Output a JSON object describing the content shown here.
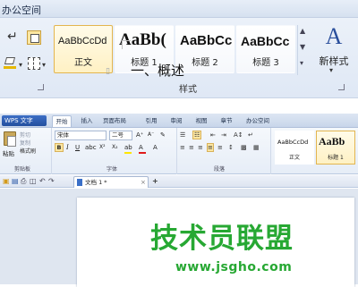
{
  "top_ribbon": {
    "tab_title": "办公空间",
    "styles": [
      {
        "sample": "AaBbCcDd",
        "caption": "正文",
        "selected": true
      },
      {
        "sample": "AaBb(",
        "caption": "标题 1",
        "selected": false
      },
      {
        "sample": "AaBbCc",
        "caption": "标题 2",
        "selected": false
      },
      {
        "sample": "AaBbCc",
        "caption": "标题 3",
        "selected": false
      }
    ],
    "new_style_label": "新样式",
    "new_style_icon_glyph": "A",
    "group_label": "样式",
    "anchor_glyph": "↵",
    "scroll_up": "▲",
    "scroll_down": "▼",
    "scroll_more": "▾",
    "dropdown_arrow": "▾"
  },
  "wps_window": {
    "app_button": "WPS 文字",
    "tabs": [
      {
        "label": "开始",
        "active": true
      },
      {
        "label": "插入",
        "active": false
      },
      {
        "label": "页面布局",
        "active": false
      },
      {
        "label": "引用",
        "active": false
      },
      {
        "label": "审阅",
        "active": false
      },
      {
        "label": "视图",
        "active": false
      },
      {
        "label": "章节",
        "active": false
      },
      {
        "label": "办公空间",
        "active": false
      }
    ],
    "clipboard": {
      "paste": "粘贴",
      "cut": "剪切",
      "copy": "复制",
      "format_painter": "格式刷",
      "group_label": "剪贴板"
    },
    "font": {
      "name": "宋体",
      "size": "二号",
      "bold": "B",
      "italic": "I",
      "underline": "U",
      "strike": "abc",
      "superscript": "X²",
      "subscript": "X₂",
      "grow": "A⁺",
      "shrink": "A⁻",
      "clear": "✎",
      "highlight": "ab",
      "color": "A",
      "char_border": "A",
      "group_label": "字体"
    },
    "paragraph": {
      "bullets": "☰",
      "numbering": "☷",
      "outdent": "⇤",
      "indent": "⇥",
      "sort": "A↕",
      "show_marks": "↵",
      "align_left": "≡",
      "align_center": "≡",
      "align_right": "≡",
      "justify": "≡",
      "distribute": "≡",
      "spacing": "↕",
      "shading": "▩",
      "border": "▦",
      "group_label": "段落"
    },
    "style_gallery": [
      {
        "sample": "AaBbCcDd",
        "caption": "正文",
        "selected": false
      },
      {
        "sample": "AaBb",
        "caption": "标题 1",
        "selected": true
      }
    ],
    "quick_access": {
      "open": "▣",
      "save": "▤",
      "print": "⎙",
      "preview": "◫",
      "undo": "↶",
      "redo": "↷"
    },
    "document_tab": {
      "label": "文档 1 *",
      "close": "×",
      "new_tab": "+"
    },
    "document": {
      "heading": "一、概述",
      "paragraph_mark": "▯"
    }
  },
  "watermark": {
    "text_cn": "技术员联盟",
    "url": "www.jsgho.com"
  },
  "colors": {
    "selected_border": "#e3b54f",
    "app_button": "#2a59a8",
    "watermark": "#27a833"
  }
}
